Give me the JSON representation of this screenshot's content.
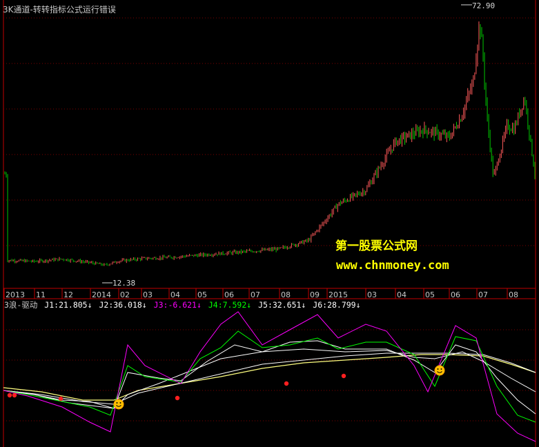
{
  "window": {
    "title": "3K通道-转转指标公式运行错误"
  },
  "watermark": {
    "line1": "第一股票公式网",
    "line2": "www.chnmoney.com",
    "color": "#ffff00"
  },
  "colors": {
    "background": "#000000",
    "frame": "#c00000",
    "grid": "#800000",
    "candle_up": "#ff5a5a",
    "candle_down": "#00c800",
    "j1": "#ffffff",
    "j2": "#ffffff",
    "j3": "#ff00ff",
    "j4": "#00ff00",
    "j5": "#ffffff",
    "j6": "#ffff80"
  },
  "indicator": {
    "name": "3浪-驱动",
    "values": [
      {
        "label": "J1:21.805↓",
        "color": "#ffffff"
      },
      {
        "label": "J2:36.018↓",
        "color": "#ffffff"
      },
      {
        "label": "J3:-6.621↓",
        "color": "#ff00ff"
      },
      {
        "label": "J4:7.592↓",
        "color": "#00ff00"
      },
      {
        "label": "J5:32.651↓",
        "color": "#ffffff"
      },
      {
        "label": "J6:28.799↓",
        "color": "#ffffff"
      }
    ]
  },
  "chart_data": [
    {
      "type": "candlestick",
      "title": "3K通道-转转指标公式运行错误",
      "x_tick_labels": [
        "2013",
        "11",
        "12",
        "2014",
        "02",
        "03",
        "04",
        "05",
        "06",
        "07",
        "08",
        "09",
        "2015",
        "03",
        "04",
        "05",
        "06",
        "07",
        "08"
      ],
      "annotations": {
        "max": "72.90",
        "min": "12.38"
      },
      "close_trend": [
        [
          "2013-10",
          13.6
        ],
        [
          "2013-11",
          13.3
        ],
        [
          "2013-12",
          13.9
        ],
        [
          "2014-01",
          13.0
        ],
        [
          "2014-01-20",
          12.38
        ],
        [
          "2014-02",
          13.4
        ],
        [
          "2014-03",
          14.0
        ],
        [
          "2014-04",
          14.3
        ],
        [
          "2014-05",
          14.8
        ],
        [
          "2014-06",
          15.3
        ],
        [
          "2014-07",
          15.8
        ],
        [
          "2014-08",
          16.4
        ],
        [
          "2014-09",
          18.5
        ],
        [
          "2014-10",
          24.0
        ],
        [
          "2014-11",
          27.5
        ],
        [
          "2014-12",
          31.0
        ],
        [
          "2015-01",
          43.0
        ],
        [
          "2015-02",
          46.0
        ],
        [
          "2015-03",
          44.0
        ],
        [
          "2015-04",
          49.0
        ],
        [
          "2015-05",
          58.0
        ],
        [
          "2015-06-10",
          72.9
        ],
        [
          "2015-06-25",
          64.0
        ],
        [
          "2015-07-05",
          50.0
        ],
        [
          "2015-07-10",
          34.0
        ],
        [
          "2015-07-20",
          47.0
        ],
        [
          "2015-08-05",
          46.0
        ],
        [
          "2015-08-15",
          54.0
        ],
        [
          "2015-08-25",
          35.0
        ]
      ],
      "ylim": [
        8,
        76
      ]
    },
    {
      "type": "line",
      "title": "3浪-驱动",
      "series": [
        {
          "name": "J1",
          "last": 21.805
        },
        {
          "name": "J2",
          "last": 36.018
        },
        {
          "name": "J3",
          "last": -6.621
        },
        {
          "name": "J4",
          "last": 7.592
        },
        {
          "name": "J5",
          "last": 32.651
        },
        {
          "name": "J6",
          "last": 28.799
        }
      ]
    }
  ]
}
